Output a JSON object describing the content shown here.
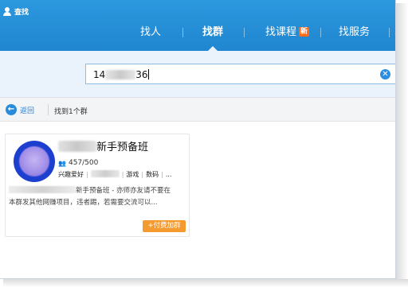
{
  "app": {
    "title": "查找"
  },
  "tabs": [
    {
      "label": "找人"
    },
    {
      "label": "找群"
    },
    {
      "label": "找课程",
      "badge": "新"
    },
    {
      "label": "找服务"
    }
  ],
  "search": {
    "value_prefix": "14",
    "value_suffix": "36"
  },
  "results": {
    "back_label": "返回",
    "count_label": "找到1个群"
  },
  "card": {
    "name_suffix": "新手预备班",
    "members": "457/500",
    "tags": {
      "first": "兴趣爱好",
      "second": "游戏",
      "third": "数码",
      "more": "..."
    },
    "description": {
      "line1_suffix": "新手预备班 - 亦师亦友请不要在",
      "line2": "本群发其他网赚项目，违者踢，若需要交流可以..."
    },
    "join_label": "+付费加群"
  },
  "colors": {
    "topbar": "#2290d8",
    "accent": "#2a8bdb",
    "join": "#f59a2e",
    "new_badge": "#ff6a1a"
  }
}
